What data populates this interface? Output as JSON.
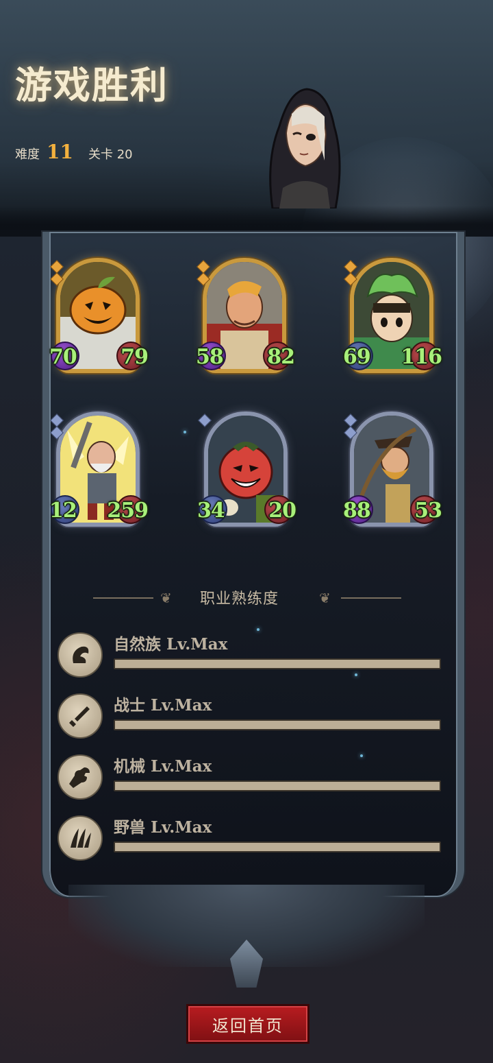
{
  "header": {
    "title": "游戏胜利",
    "difficulty_label": "难度",
    "difficulty_value": "11",
    "stage_label": "关卡 20"
  },
  "heroes": [
    {
      "name": "pumpkin",
      "rarity": "gold",
      "left": "70",
      "left_badge": "purple",
      "right": "79"
    },
    {
      "name": "warrior",
      "rarity": "gold",
      "left": "58",
      "left_badge": "purple",
      "right": "82"
    },
    {
      "name": "sprout",
      "rarity": "gold",
      "left": "69",
      "left_badge": "blue",
      "right": "116"
    },
    {
      "name": "engineer",
      "rarity": "silver",
      "left": "12",
      "left_badge": "blue",
      "right": "259"
    },
    {
      "name": "tomato",
      "rarity": "silver",
      "left": "34",
      "left_badge": "blue",
      "right": "20"
    },
    {
      "name": "pirate",
      "rarity": "silver",
      "left": "88",
      "left_badge": "purple",
      "right": "53"
    }
  ],
  "proficiency": {
    "title": "职业熟练度",
    "rows": [
      {
        "label": "自然族 Lv.Max",
        "icon": "nature-icon",
        "progress": 1.0
      },
      {
        "label": "战士 Lv.Max",
        "icon": "sword-icon",
        "progress": 1.0
      },
      {
        "label": "机械 Lv.Max",
        "icon": "wrench-icon",
        "progress": 1.0
      },
      {
        "label": "野兽 Lv.Max",
        "icon": "claw-icon",
        "progress": 1.0
      }
    ]
  },
  "footer": {
    "return_label": "返回首页"
  },
  "colors": {
    "accent_gold": "#f3b13e",
    "stat_green": "#a8f07a",
    "button_red": "#b81c20"
  }
}
